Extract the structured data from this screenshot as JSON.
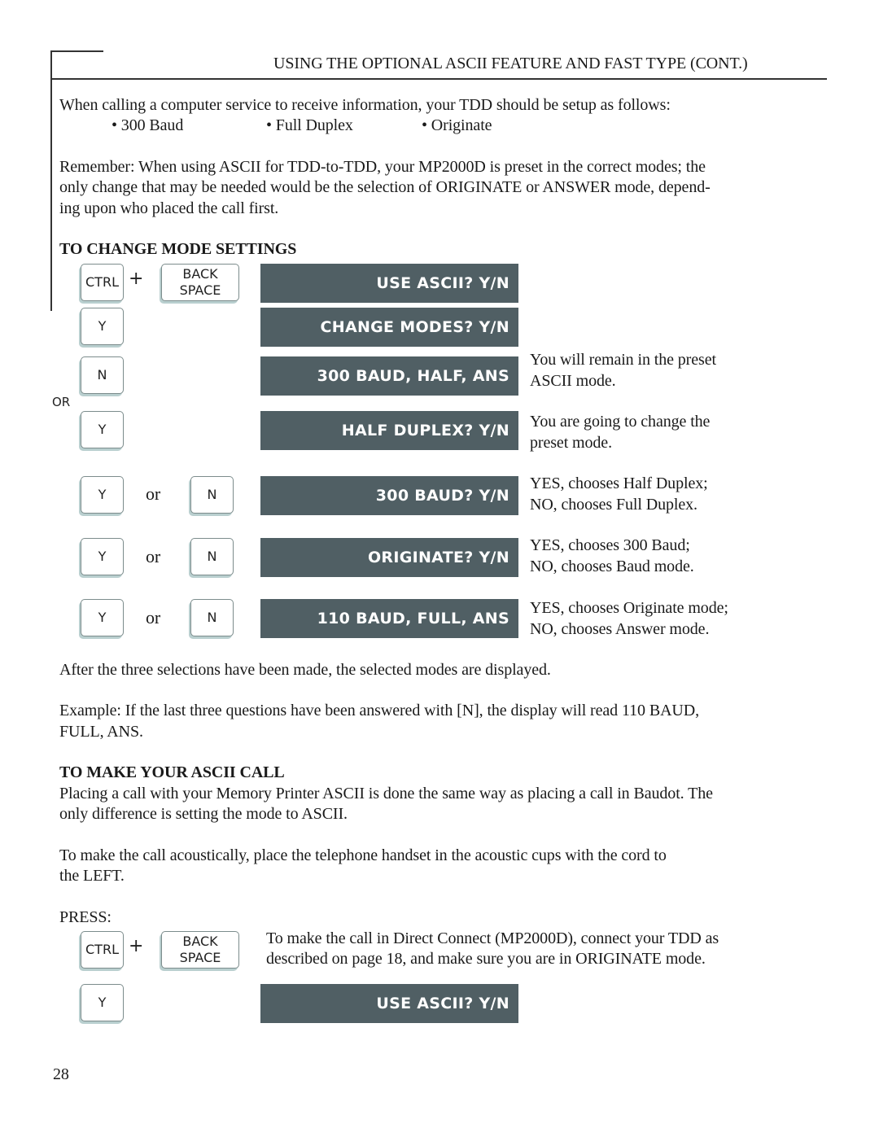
{
  "header": {
    "title": "USING THE OPTIONAL ASCII FEATURE AND FAST TYPE (CONT.)"
  },
  "intro": {
    "line": "When calling a computer service to receive information, your TDD should be setup as follows:",
    "bullets": [
      "• 300 Baud",
      "• Full Duplex",
      "• Originate"
    ]
  },
  "remember": {
    "lines": [
      "Remember: When using ASCII for TDD-to-TDD, your MP2000D is preset in the correct modes; the",
      "only change that may be needed would be the selection of ORIGINATE or ANSWER mode, depend-",
      "ing upon who placed the call first."
    ]
  },
  "change_mode": {
    "heading": "TO CHANGE MODE SETTINGS",
    "keys": {
      "ctrl": "CTRL",
      "plus": "+",
      "backspace_line1": "BACK",
      "backspace_line2": "SPACE",
      "y": "Y",
      "n": "N",
      "or_caps": "OR",
      "or_word": "or"
    },
    "displays": [
      "USE ASCII? Y/N",
      "CHANGE MODES? Y/N",
      "300 BAUD, HALF, ANS",
      "HALF DUPLEX? Y/N",
      "300 BAUD? Y/N",
      "ORIGINATE? Y/N",
      "110 BAUD, FULL, ANS"
    ],
    "notes": [
      [
        "You will remain in the preset",
        "ASCII mode."
      ],
      [
        "You are going to change the",
        "preset mode."
      ],
      [
        "YES, chooses Half Duplex;",
        "NO, chooses Full Duplex."
      ],
      [
        "YES, chooses 300 Baud;",
        "NO, chooses Baud mode."
      ],
      [
        "YES, chooses Originate mode;",
        "NO, chooses Answer mode."
      ]
    ]
  },
  "after": {
    "line": "After the three selections have been made, the selected modes are displayed.",
    "example_lines": [
      "Example: If the last three questions have been answered with [N], the display will read 110 BAUD,",
      "FULL, ANS."
    ]
  },
  "make_call": {
    "heading": "TO MAKE YOUR ASCII CALL",
    "lines": [
      "Placing a call with your Memory Printer ASCII is done the same way as placing a call in Baudot. The",
      "only difference is setting the mode to ASCII."
    ],
    "acoustic_lines": [
      "To make the call acoustically, place the telephone handset in the acoustic cups with the cord to",
      "the LEFT."
    ],
    "press_label": "PRESS:",
    "direct_lines": [
      "To make the call in Direct Connect (MP2000D), connect your TDD as",
      "described on page 18, and make sure you are in ORIGINATE mode."
    ],
    "display": "USE ASCII? Y/N"
  },
  "page_number": "28"
}
